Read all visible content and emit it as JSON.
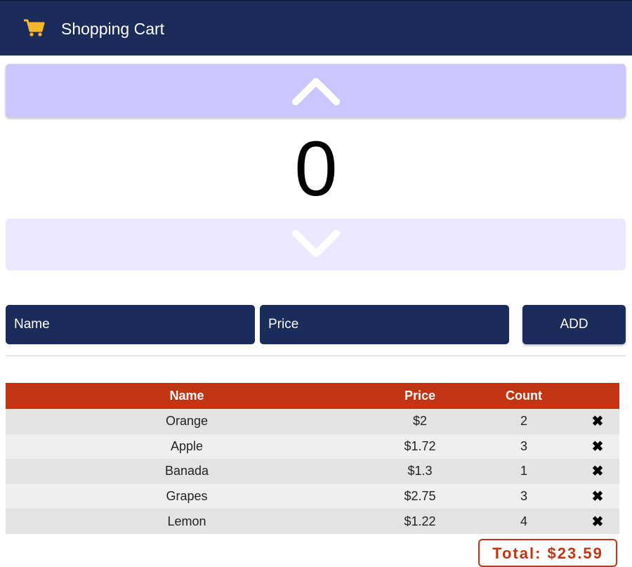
{
  "header": {
    "title": "Shopping Cart",
    "icon": "shopping-cart-icon",
    "icon_color": "#f4b82e",
    "bar_color": "#1b2b5a"
  },
  "counter": {
    "value": "0",
    "up_icon": "chevron-up-icon",
    "down_icon": "chevron-down-icon"
  },
  "form": {
    "name_placeholder": "Name",
    "price_placeholder": "Price",
    "add_label": "ADD"
  },
  "table": {
    "header_color": "#c13515",
    "columns": [
      "Name",
      "Price",
      "Count",
      ""
    ],
    "rows": [
      {
        "name": "Orange",
        "price": "$2",
        "count": "2",
        "delete": "✖"
      },
      {
        "name": "Apple",
        "price": "$1.72",
        "count": "3",
        "delete": "✖"
      },
      {
        "name": "Banada",
        "price": "$1.3",
        "count": "1",
        "delete": "✖"
      },
      {
        "name": "Grapes",
        "price": "$2.75",
        "count": "3",
        "delete": "✖"
      },
      {
        "name": "Lemon",
        "price": "$1.22",
        "count": "4",
        "delete": "✖"
      }
    ]
  },
  "total": {
    "label": "Total: $23.59"
  }
}
